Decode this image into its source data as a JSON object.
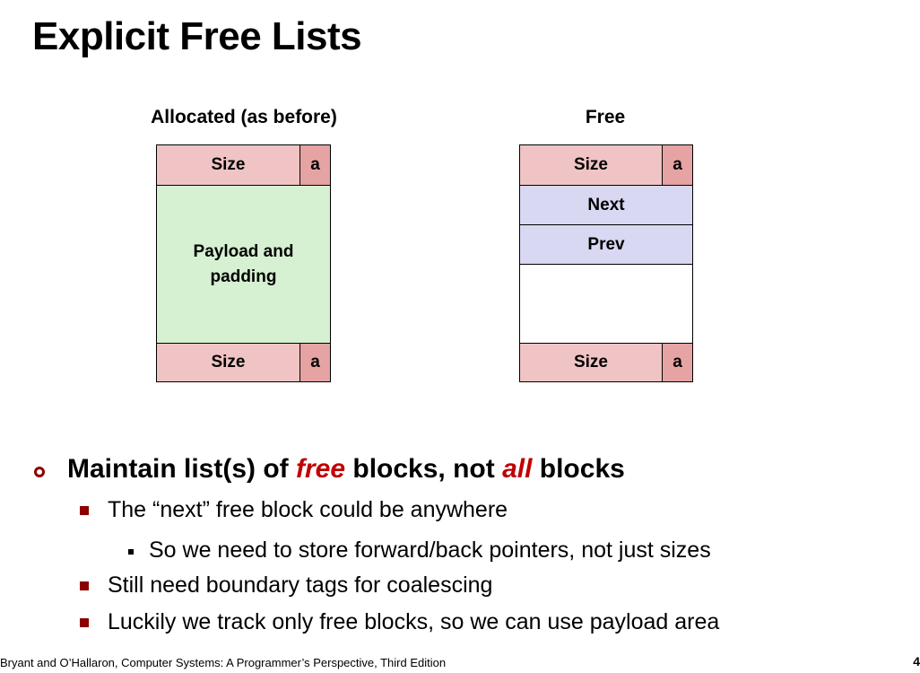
{
  "title": "Explicit Free Lists",
  "allocated": {
    "caption": "Allocated (as before)",
    "header_size": "Size",
    "header_flag": "a",
    "payload": "Payload and padding",
    "footer_size": "Size",
    "footer_flag": "a"
  },
  "free": {
    "caption": "Free",
    "header_size": "Size",
    "header_flag": "a",
    "next": "Next",
    "prev": "Prev",
    "footer_size": "Size",
    "footer_flag": "a"
  },
  "bullets": {
    "main_part1": "Maintain list(s) of ",
    "main_em1": "free",
    "main_part2": " blocks, not ",
    "main_em2": "all",
    "main_part3": " blocks",
    "sub1": "The “next” free block could be anywhere",
    "sub1_1": "So we need to store forward/back pointers, not just sizes",
    "sub2": "Still need boundary tags for coalescing",
    "sub3": "Luckily we track only free blocks, so we can use payload area"
  },
  "footer": "Bryant and O’Hallaron, Computer Systems: A Programmer’s Perspective, Third Edition",
  "page_number": "4",
  "colors": {
    "header_fill": "#f0c4c4",
    "flag_fill": "#e6a3a3",
    "payload_fill": "#d6f0d2",
    "pointer_fill": "#d8d8f2",
    "emphasis": "#c00000",
    "bullet_marker": "#8b0000"
  }
}
